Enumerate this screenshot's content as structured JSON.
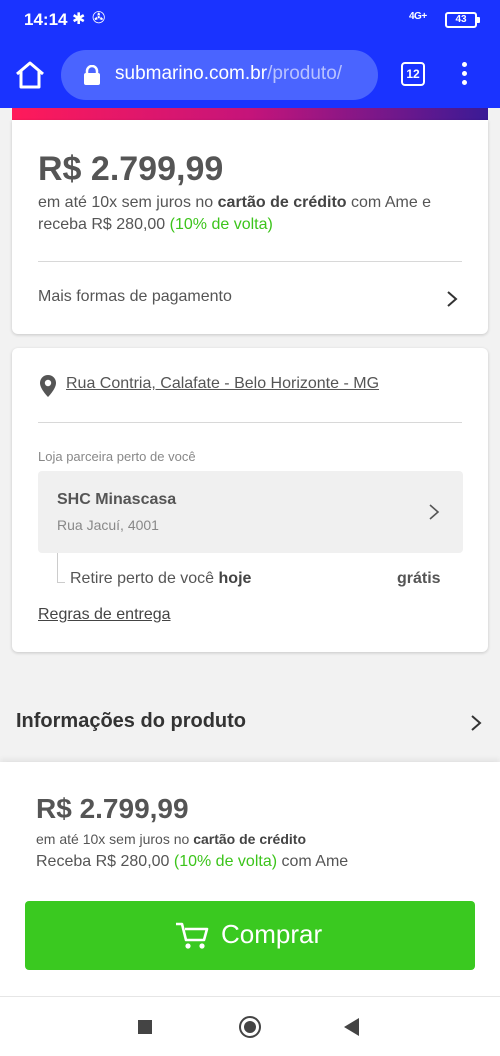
{
  "status_bar": {
    "time": "14:14",
    "network": "4G+",
    "battery": "43"
  },
  "browser": {
    "domain": "submarino.com.br",
    "path": "/produto/",
    "tab_count": "12"
  },
  "price_card": {
    "price": "R$ 2.799,99",
    "installments_prefix": "em até 10x sem juros no ",
    "installments_bold": "cartão de crédito",
    "installments_suffix": " com Ame e receba R$ 280,00 ",
    "cashback": "(10% de volta)",
    "more_payment": "Mais formas de pagamento"
  },
  "delivery_card": {
    "address": "Rua Contria, Calafate - Belo Horizonte - MG",
    "store_caption": "Loja parceira perto de você",
    "store_name": "SHC Minascasa",
    "store_address": "Rua Jacuí, 4001",
    "pickup_prefix": "Retire perto de você ",
    "pickup_bold": "hoje",
    "pickup_price": "grátis",
    "rules_link": "Regras de entrega"
  },
  "product_info": {
    "title": "Informações do produto"
  },
  "purchase_sheet": {
    "price": "R$ 2.799,99",
    "installments_prefix": "em até 10x sem juros no ",
    "installments_bold": "cartão de crédito",
    "cash_prefix": "Receba R$ 280,00 ",
    "cashback": "(10% de volta)",
    "cash_suffix": " com Ame",
    "buy_label": "Comprar"
  },
  "colors": {
    "browser_blue": "#1a33ff",
    "buy_green": "#3ac920",
    "cashback_green": "#3cc41b"
  },
  "icons": [
    "home-icon",
    "lock-icon",
    "tabs-icon",
    "overflow-menu-icon",
    "chevron-right-icon",
    "location-pin-icon",
    "cart-icon",
    "nav-recents-icon",
    "nav-home-icon",
    "nav-back-icon"
  ]
}
